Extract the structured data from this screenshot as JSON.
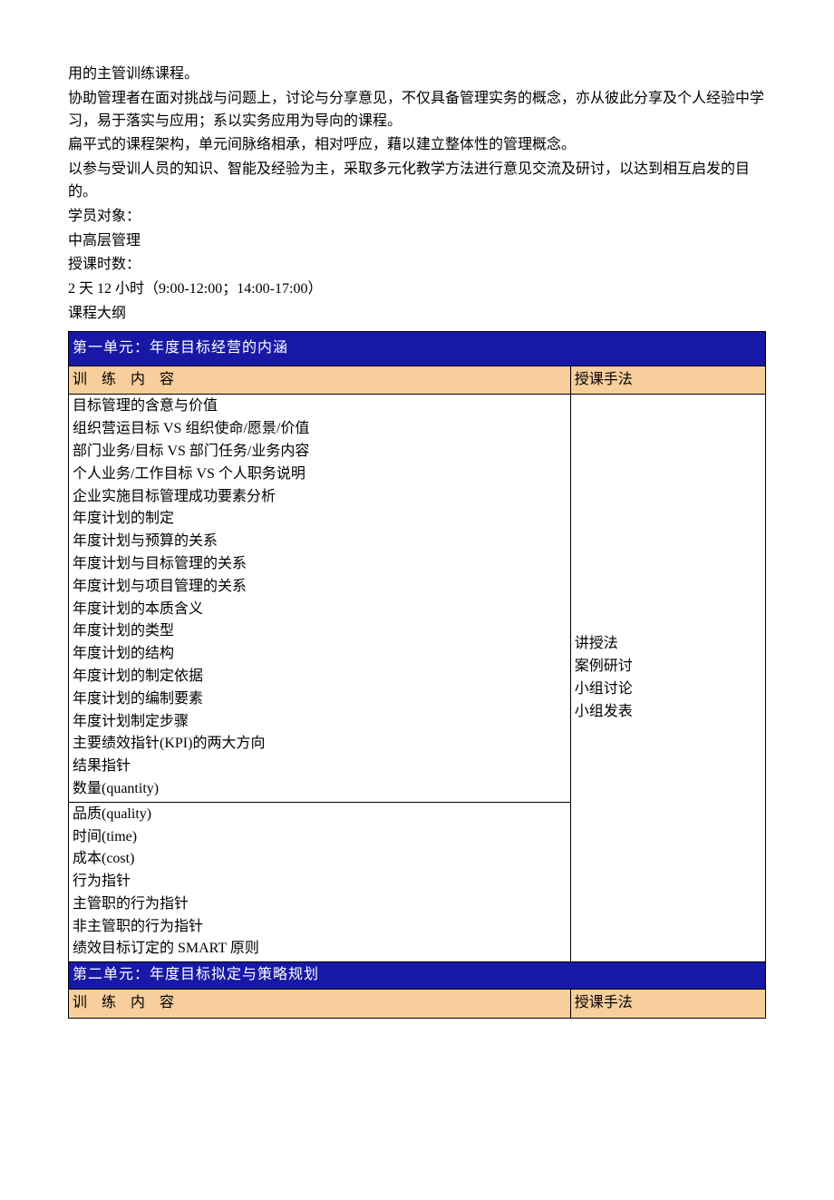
{
  "intro": {
    "line1": "用的主管训练课程。",
    "line2": "协助管理者在面对挑战与问题上，讨论与分享意见，不仅具备管理实务的概念，亦从彼此分享及个人经验中学习，易于落实与应用；系以实务应用为导向的课程。",
    "line3": "扁平式的课程架构，单元间脉络相承，相对呼应，藉以建立整体性的管理概念。",
    "line4": "以参与受训人员的知识、智能及经验为主，采取多元化教学方法进行意见交流及研讨，以达到相互启发的目的。",
    "audience_label": "学员对象：",
    "audience_value": "中高层管理",
    "hours_label": "授课时数：",
    "hours_value": "2 天 12 小时（9:00-12:00；14:00-17:00）",
    "outline_label": "课程大纲"
  },
  "table": {
    "unit1_title": "第一单元：年度目标经营的内涵",
    "col_content_spaced": "训　练　内　容",
    "col_method": "授课手法",
    "unit1_content_a": [
      "目标管理的含意与价值",
      "组织营运目标 VS 组织使命/愿景/价值",
      "部门业务/目标 VS 部门任务/业务内容",
      "个人业务/工作目标 VS 个人职务说明",
      "企业实施目标管理成功要素分析",
      "年度计划的制定",
      "年度计划与预算的关系",
      "年度计划与目标管理的关系",
      "年度计划与项目管理的关系",
      "年度计划的本质含义",
      "年度计划的类型",
      "年度计划的结构",
      "年度计划的制定依据",
      "年度计划的编制要素",
      "年度计划制定步骤",
      "主要绩效指针(KPI)的两大方向",
      "结果指针",
      "数量(quantity)"
    ],
    "unit1_methods": [
      "讲授法",
      "案例研讨",
      "小组讨论",
      "小组发表"
    ],
    "unit1_content_b": [
      "品质(quality)",
      "时间(time)",
      "成本(cost)",
      "行为指针",
      "主管职的行为指针",
      "非主管职的行为指针",
      "绩效目标订定的 SMART 原则"
    ],
    "unit2_title": "第二单元：年度目标拟定与策略规划"
  }
}
